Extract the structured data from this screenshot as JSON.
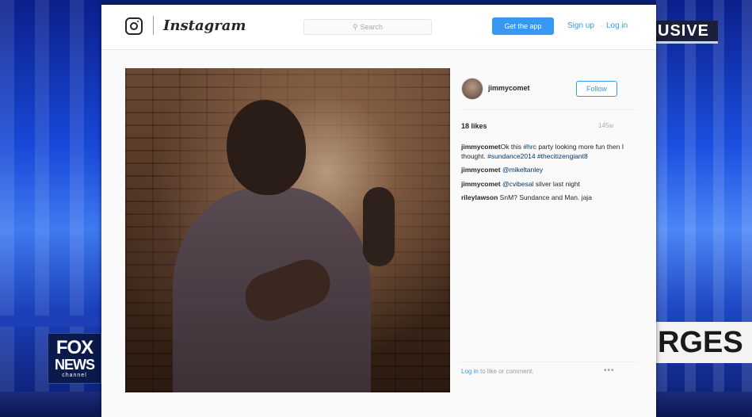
{
  "broadcast": {
    "top_banner": "USIVE",
    "lower_third": "RGES",
    "logo": {
      "line1": "FOX",
      "line2": "NEWS",
      "line3": "channel"
    }
  },
  "instagram": {
    "wordmark": "Instagram",
    "search_placeholder": "Search",
    "get_app_label": "Get the app",
    "signup_label": "Sign up",
    "separator": "·",
    "login_label": "Log in",
    "post": {
      "username": "jimmycomet",
      "follow_label": "Follow",
      "likes": "18 likes",
      "age": "145w",
      "comments": [
        {
          "user": "jimmycomet",
          "text": "Ok this ",
          "tag1": "#hrc",
          "text2": " party looking more fun then I thought. ",
          "tag2": "#sundance2014 #thecitizengiant8"
        },
        {
          "user": "jimmycomet",
          "text": " ",
          "tag1": "@mikeltanley",
          "text2": "",
          "tag2": ""
        },
        {
          "user": "jimmycomet",
          "text": " ",
          "tag1": "@cvibesal",
          "text2": " silver last night",
          "tag2": ""
        },
        {
          "user": "rileylawson",
          "text": " SnM? Sundance and Man. jaja",
          "tag1": "",
          "text2": "",
          "tag2": ""
        }
      ],
      "footer_login": "Log in",
      "footer_text": " to like or comment.",
      "more": "•••"
    }
  }
}
